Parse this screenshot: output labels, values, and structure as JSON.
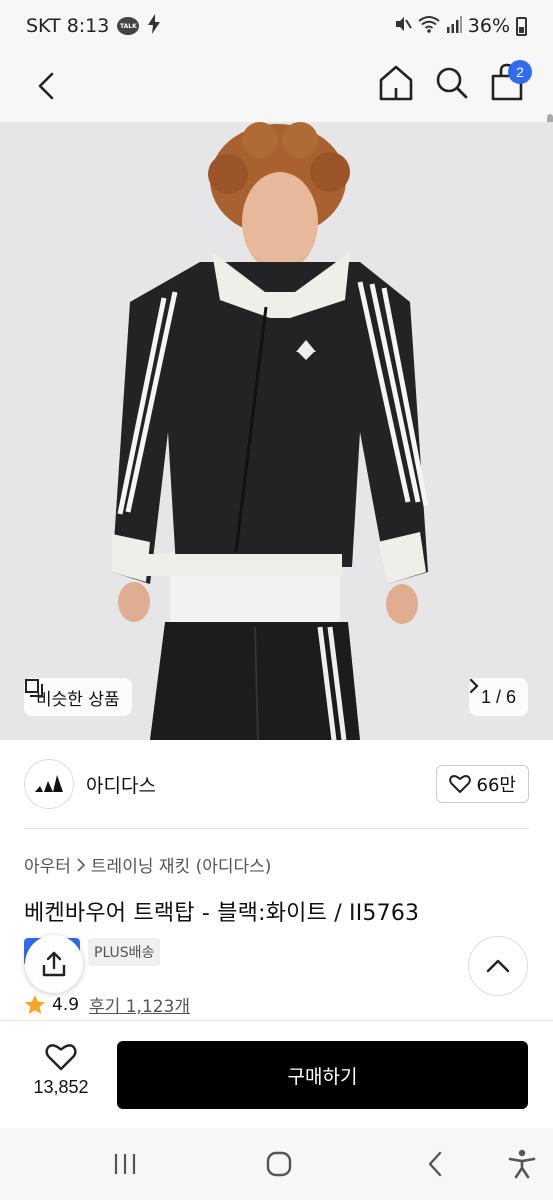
{
  "status_bar": {
    "carrier_time": "SKT 8:13",
    "talk_badge": "TALK",
    "battery": "36%"
  },
  "app_bar": {
    "cart_count": "2"
  },
  "hero": {
    "similar_label": "비슷한 상품",
    "pager": "1 / 6"
  },
  "brand": {
    "name": "아디다스",
    "likes": "66만"
  },
  "product": {
    "breadcrumb_root": "아우터",
    "breadcrumb_child": "트레이닝 재킷 (아디다스)",
    "title": "베켄바우어 트랙탑 - 블랙:화이트 / II5763",
    "delivery_label": "PLUS배송",
    "rating": "4.9",
    "reviews": "후기 1,123개"
  },
  "purchase": {
    "wish_count": "13,852",
    "buy_label": "구매하기"
  },
  "colors": {
    "accent_blue": "#2f6cf0",
    "buy_button": "#000000",
    "star": "#f5a623"
  }
}
